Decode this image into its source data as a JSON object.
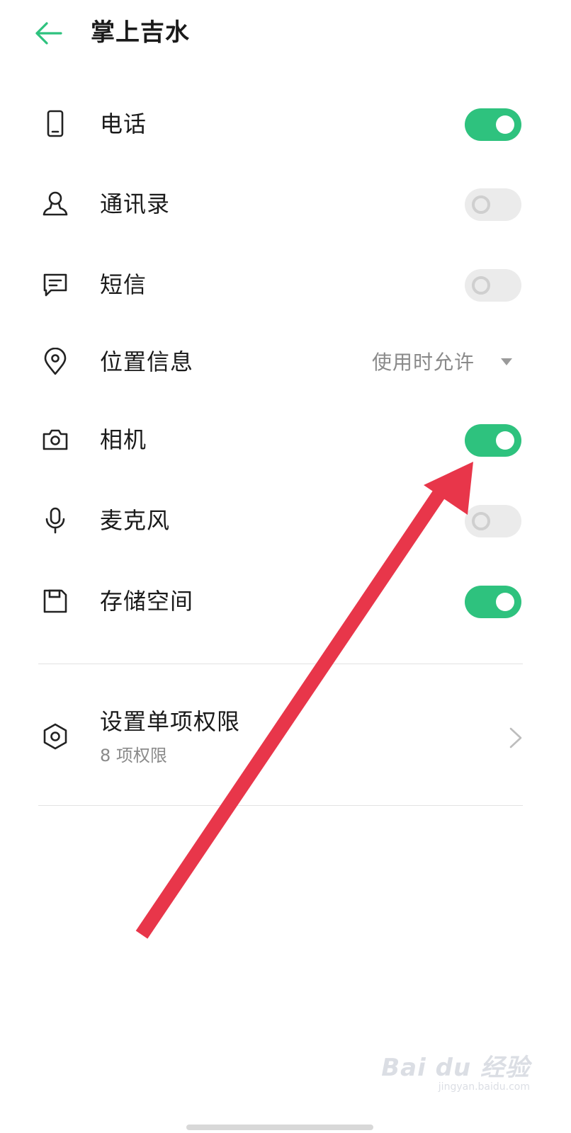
{
  "header": {
    "title": "掌上吉水",
    "back_icon": "arrow-left-icon"
  },
  "colors": {
    "accent": "#2ec27e",
    "toggle_off": "#ebebeb",
    "arrow": "#e8364a"
  },
  "permissions": [
    {
      "icon": "phone-icon",
      "label": "电话",
      "type": "toggle",
      "enabled": true
    },
    {
      "icon": "contacts-icon",
      "label": "通讯录",
      "type": "toggle",
      "enabled": false
    },
    {
      "icon": "sms-icon",
      "label": "短信",
      "type": "toggle",
      "enabled": false
    },
    {
      "icon": "location-icon",
      "label": "位置信息",
      "type": "select",
      "value": "使用时允许"
    },
    {
      "icon": "camera-icon",
      "label": "相机",
      "type": "toggle",
      "enabled": true
    },
    {
      "icon": "microphone-icon",
      "label": "麦克风",
      "type": "toggle",
      "enabled": false
    },
    {
      "icon": "storage-icon",
      "label": "存储空间",
      "type": "toggle",
      "enabled": true
    }
  ],
  "single_permissions": {
    "icon": "hexagon-settings-icon",
    "title": "设置单项权限",
    "subtitle": "8 项权限"
  },
  "watermark": {
    "main": "Bai du 经验",
    "sub": "jingyan.baidu.com"
  }
}
